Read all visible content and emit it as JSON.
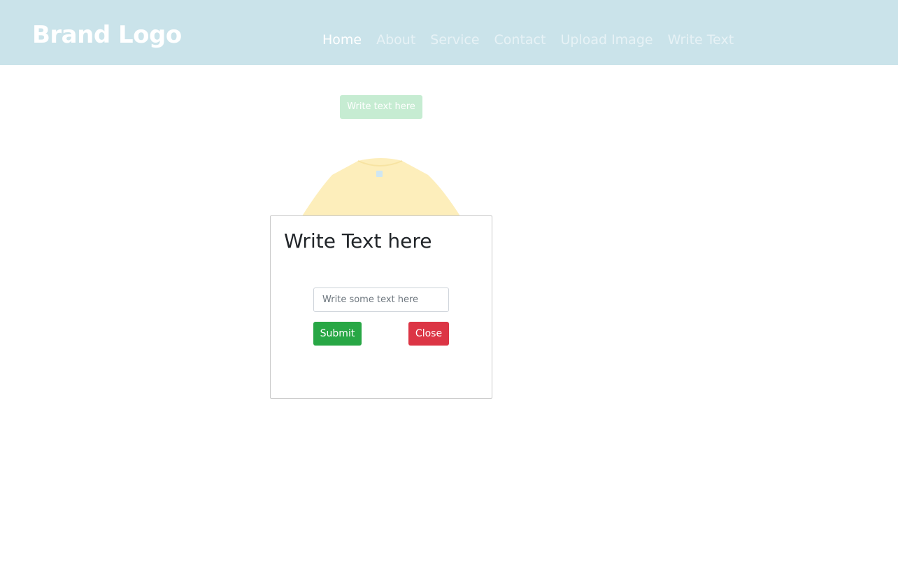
{
  "navbar": {
    "brand": "Brand Logo",
    "links": [
      {
        "label": "Home",
        "active": true
      },
      {
        "label": "About",
        "active": false
      },
      {
        "label": "Service",
        "active": false
      },
      {
        "label": "Contact",
        "active": false
      },
      {
        "label": "Upload Image",
        "active": false
      },
      {
        "label": "Write Text",
        "active": false
      }
    ],
    "background_color": "#cae3ea"
  },
  "main": {
    "write_text_button_label": "Write text here",
    "shirt_color": "#fdeebb"
  },
  "modal": {
    "title": "Write Text here",
    "input": {
      "value": "",
      "placeholder": "Write some text here"
    },
    "submit_label": "Submit",
    "close_label": "Close",
    "submit_color": "#28a745",
    "close_color": "#dc3545"
  }
}
